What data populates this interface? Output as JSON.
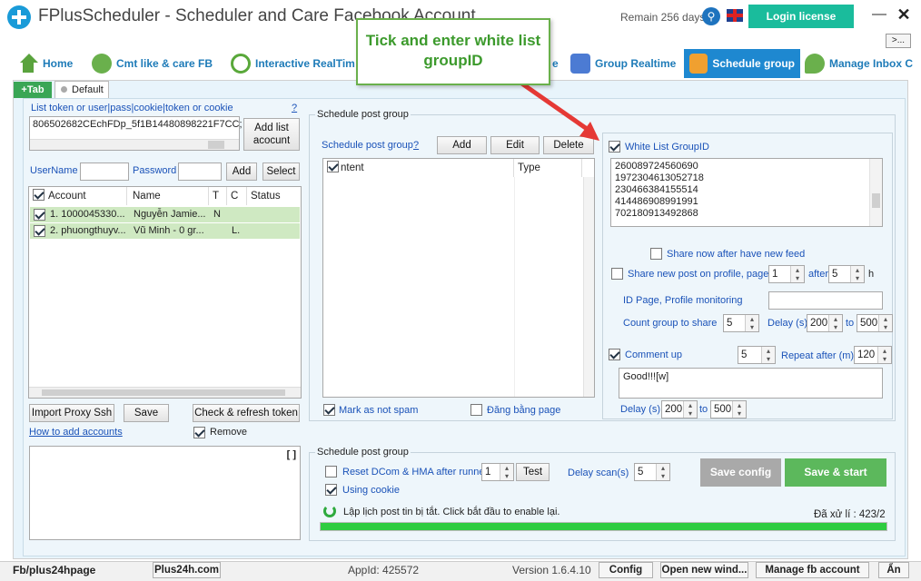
{
  "window": {
    "title": "FPlusScheduler - Scheduler and Care Facebook Account",
    "remain": "Remain 256 days",
    "login_label": "Login license",
    "more_label": ">..."
  },
  "callout": {
    "text": "Tick and enter white list groupID"
  },
  "nav": {
    "home": "Home",
    "cmt": "Cmt like & care FB",
    "interactive": "Interactive RealTim",
    "partial": "e",
    "group_realtime": "Group Realtime",
    "schedule_group": "Schedule group",
    "manage_inbox": "Manage Inbox C"
  },
  "tabs": {
    "plus": "+Tab",
    "default": "Default"
  },
  "left": {
    "token_label": "List token or user|pass|cookie|token or cookie",
    "help": "?",
    "token_value": "806502682CEchFDp_5f1B14480898221F7CC;",
    "add_list_label": "Add list acocunt",
    "username_label": "UserName",
    "password_label": "Password",
    "add_label": "Add",
    "select_label": "Select",
    "columns": {
      "account": "Account",
      "name": "Name",
      "t": "T",
      "c": "C",
      "status": "Status"
    },
    "rows": [
      {
        "account": "1. 1000045330...",
        "name": "Nguyễn Jamie...",
        "t": "N",
        "c": "",
        "status": ""
      },
      {
        "account": "2. phuongthuyv...",
        "name": "Vũ Minh - 0 gr...",
        "t": "",
        "c": "L.",
        "status": ""
      }
    ],
    "import_proxy": "Import Proxy Ssh",
    "save": "Save",
    "check_refresh": "Check & refresh token",
    "how_to": "How to add accounts",
    "remove": "Remove",
    "log_marker": "[ ]"
  },
  "schedule": {
    "group_title": "Schedule post group",
    "list_label": "Schedule post group",
    "help": "?",
    "add": "Add",
    "edit": "Edit",
    "delete": "Delete",
    "col_content": "ntent",
    "col_type": "Type",
    "mark_spam": "Mark as not spam",
    "dang_bang_page": "Đăng bằng page"
  },
  "whitelist": {
    "label": "White List GroupID",
    "ids": [
      "260089724560690",
      "1972304613052718",
      "230466384155514",
      "414486908991991",
      "702180913492868"
    ]
  },
  "options": {
    "share_now": "Share now after have new feed",
    "share_profile": "Share new post on profile, page",
    "share_profile_value": "1",
    "after_label": "after",
    "after_value": "5",
    "h_label": "h",
    "id_page_label": "ID Page, Profile monitoring",
    "id_page_value": "",
    "count_group_label": "Count group to share",
    "count_group_value": "5",
    "delay_s_label": "Delay (s)",
    "delay_from": "200",
    "to_label": "to",
    "delay_to": "500",
    "comment_up": "Comment up",
    "comment_count": "5",
    "repeat_label": "Repeat after (m)",
    "repeat_value": "120",
    "comment_text": "Good!!![w]",
    "delay2_label": "Delay (s)",
    "delay2_from": "200",
    "to2_label": "to",
    "delay2_to": "500"
  },
  "bottom": {
    "title": "Schedule post group",
    "reset_dcom": "Reset DCom & HMA after runned",
    "reset_value": "1",
    "test": "Test",
    "delay_scan_label": "Delay scan(s)",
    "delay_scan_value": "5",
    "using_cookie": "Using cookie",
    "save_config": "Save config",
    "save_start": "Save & start",
    "status_msg": "Lập lịch post tin bị tắt. Click bắt đầu to enable lại.",
    "processed": "Đã xử lí : 423/2"
  },
  "statusbar": {
    "fb": "Fb/plus24hpage",
    "site": "Plus24h.com",
    "appid": "AppId: 425572",
    "version": "Version 1.6.4.10",
    "config": "Config",
    "open_new": "Open new wind...",
    "manage_fb": "Manage fb account",
    "an": "Ẩn"
  }
}
